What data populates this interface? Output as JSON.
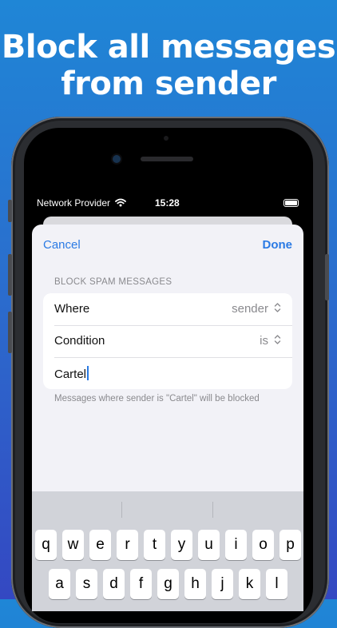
{
  "headline": {
    "line1": "Block all messages",
    "line2": "from sender"
  },
  "status_bar": {
    "carrier": "Network Provider",
    "time": "15:28"
  },
  "nav": {
    "cancel_label": "Cancel",
    "done_label": "Done"
  },
  "form": {
    "section_header": "BLOCK SPAM MESSAGES",
    "rows": [
      {
        "label": "Where",
        "value": "sender"
      },
      {
        "label": "Condition",
        "value": "is"
      }
    ],
    "text_value": "Cartel",
    "footer": "Messages where sender is \"Cartel\" will be blocked"
  },
  "keyboard": {
    "row1": [
      "q",
      "w",
      "e",
      "r",
      "t",
      "y",
      "u",
      "i",
      "o",
      "p"
    ],
    "row2": [
      "a",
      "s",
      "d",
      "f",
      "g",
      "h",
      "j",
      "k",
      "l"
    ]
  },
  "colors": {
    "accent": "#2a7ae4",
    "background_top": "#1f86d6",
    "background_bottom": "#3448c2"
  }
}
